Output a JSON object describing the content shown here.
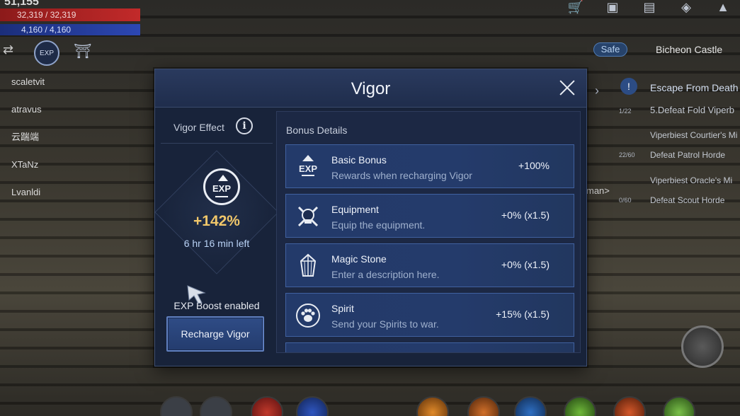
{
  "hud": {
    "top_number": "51,155",
    "hp": "32,319 / 32,319",
    "mp": "4,160 / 4,160",
    "exp_label": "EXP",
    "party": [
      "scaletvit",
      "atravus",
      "云踹端",
      "XTaNz",
      "Lvanldi"
    ],
    "safe_label": "Safe",
    "location": "Bicheon Castle",
    "quests": [
      {
        "title": "Escape From Death",
        "type": "main"
      },
      {
        "count": "1/22",
        "line": "5.Defeat Fold Viperb"
      },
      {
        "line": "Viperbiest Courtier's Mi"
      },
      {
        "count": "22/60",
        "line": "Defeat Patrol Horde"
      },
      {
        "line": "Viperbiest Oracle's Mi"
      },
      {
        "count": "0/60",
        "line": "Defeat Scout Horde"
      }
    ],
    "man_label": "man>"
  },
  "dialog": {
    "title": "Vigor",
    "close_icon": "close-icon",
    "left": {
      "label": "Vigor Effect",
      "info_icon": "info-icon",
      "exp_icon": "EXP",
      "percent": "+142%",
      "time_left": "6 hr 16 min left",
      "boost_status": "EXP Boost enabled",
      "recharge_label": "Recharge Vigor"
    },
    "bonus": {
      "title": "Bonus Details",
      "rows": [
        {
          "icon": "exp-up-icon",
          "icon_text": "EXP",
          "name": "Basic Bonus",
          "desc": "Rewards when recharging Vigor",
          "value": "+100%"
        },
        {
          "icon": "equipment-icon",
          "name": "Equipment",
          "desc": "Equip the equipment.",
          "value": "+0% (x1.5)"
        },
        {
          "icon": "magic-stone-icon",
          "name": "Magic Stone",
          "desc": "Enter a description here.",
          "value": "+0% (x1.5)"
        },
        {
          "icon": "spirit-paw-icon",
          "name": "Spirit",
          "desc": "Send your Spirits to war.",
          "value": "+15% (x1.5)"
        }
      ]
    }
  }
}
